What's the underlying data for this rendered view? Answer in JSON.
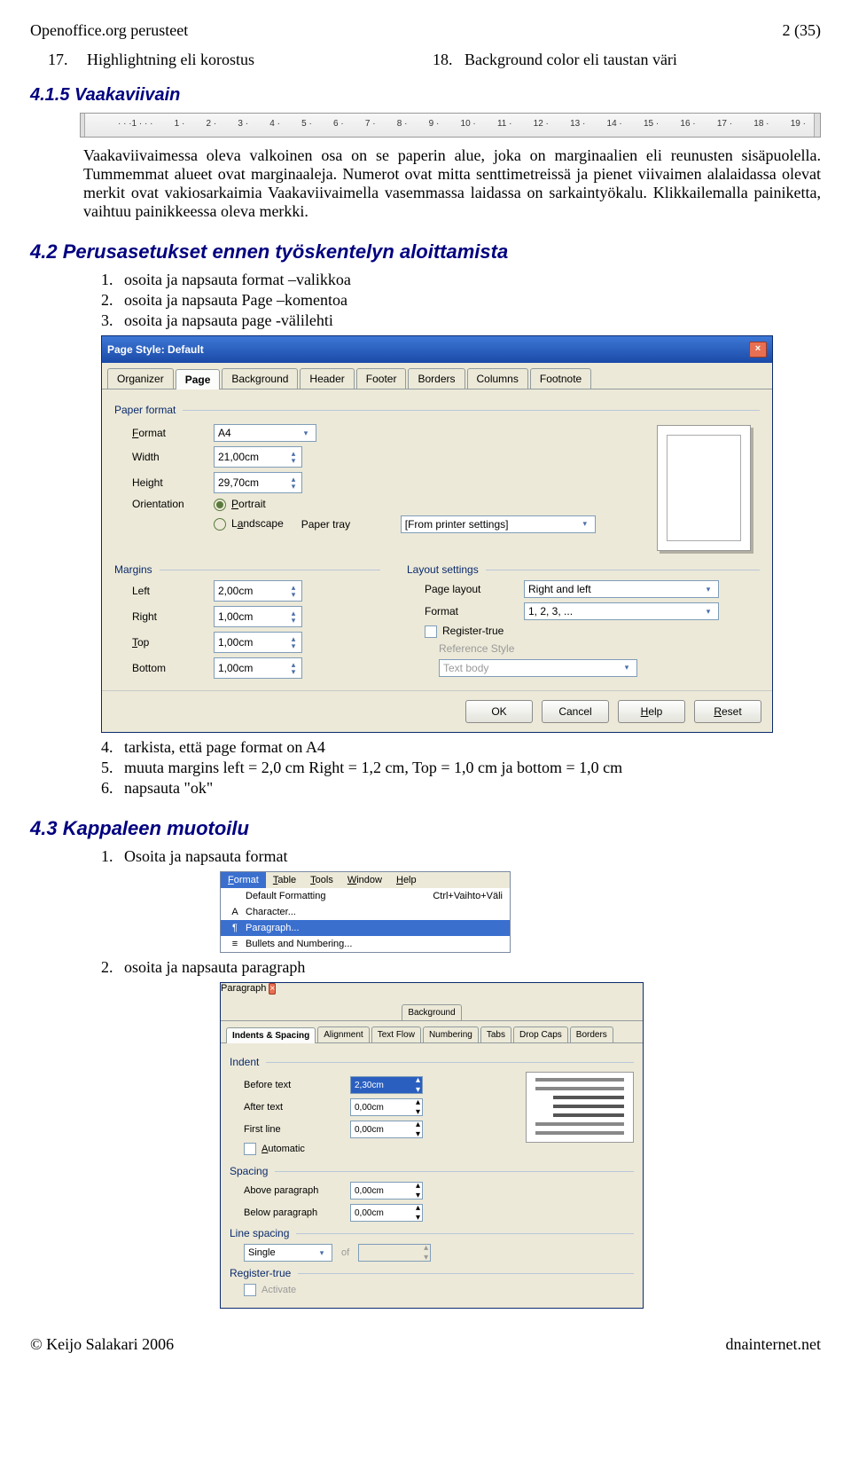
{
  "header": {
    "leftTitle": "Openoffice.org perusteet",
    "pageInfo": "2 (35)"
  },
  "rows": [
    {
      "num": "17.",
      "label": "Highlightning eli korostus",
      "num2": "18.",
      "label2": "Background color eli taustan väri"
    }
  ],
  "section415": {
    "title": "4.1.5  Vaakaviivain",
    "para": "Vaakaviivaimessa oleva valkoinen osa on se paperin alue, joka on marginaalien eli reunusten sisäpuolella. Tummemmat alueet ovat marginaaleja. Numerot ovat mitta senttimetreissä ja pienet viivaimen alalaidassa olevat merkit ovat vakiosarkaimia Vaakaviivaimella vasemmassa laidassa on sarkaintyökalu. Klikkailemalla painiketta, vaihtuu painikkeessa oleva merkki.",
    "ruler_ticks": [
      "1",
      "1",
      "2",
      "3",
      "4",
      "5",
      "6",
      "7",
      "8",
      "9",
      "10",
      "11",
      "12",
      "13",
      "14",
      "15",
      "16",
      "17",
      "18",
      "19"
    ]
  },
  "section42": {
    "title": "4.2  Perusasetukset ennen työskentelyn aloittamista",
    "steps_before": [
      "osoita ja napsauta format –valikkoa",
      "osoita ja napsauta Page –komentoa",
      "osoita ja napsauta page -välilehti"
    ],
    "steps_after": [
      "tarkista, että page format on A4",
      "muuta margins left = 2,0 cm Right = 1,2 cm, Top = 1,0 cm ja bottom = 1,0 cm",
      "napsauta \"ok\""
    ]
  },
  "dialog": {
    "title": "Page Style: Default",
    "tabs": [
      "Organizer",
      "Page",
      "Background",
      "Header",
      "Footer",
      "Borders",
      "Columns",
      "Footnote"
    ],
    "activeTab": "Page",
    "paperFormat": {
      "group": "Paper format",
      "format_lbl": "Format",
      "format_val": "A4",
      "width_lbl": "Width",
      "width_val": "21,00cm",
      "height_lbl": "Height",
      "height_val": "29,70cm",
      "orientation_lbl": "Orientation",
      "portrait": "Portrait",
      "landscape": "Landscape",
      "tray_lbl": "Paper tray",
      "tray_val": "[From printer settings]"
    },
    "margins": {
      "group": "Margins",
      "left_lbl": "Left",
      "left_val": "2,00cm",
      "right_lbl": "Right",
      "right_val": "1,00cm",
      "top_lbl": "Top",
      "top_val": "1,00cm",
      "bottom_lbl": "Bottom",
      "bottom_val": "1,00cm"
    },
    "layout": {
      "group": "Layout settings",
      "pagelayout_lbl": "Page layout",
      "pagelayout_val": "Right and left",
      "format_lbl": "Format",
      "format_val": "1, 2, 3, ...",
      "register_lbl": "Register-true",
      "refstyle_lbl": "Reference Style",
      "refstyle_val": "Text body"
    },
    "buttons": {
      "ok": "OK",
      "cancel": "Cancel",
      "help": "Help",
      "reset": "Reset"
    }
  },
  "section43": {
    "title": "4.3  Kappaleen muotoilu",
    "step1": "Osoita ja napsauta format",
    "step2": "osoita ja napsauta paragraph"
  },
  "menu": {
    "items": [
      "Format",
      "Table",
      "Tools",
      "Window",
      "Help"
    ],
    "dd": [
      {
        "icon": "",
        "label": "Default Formatting",
        "shortcut": "Ctrl+Vaihto+Väli"
      },
      {
        "icon": "A",
        "label": "Character...",
        "shortcut": ""
      },
      {
        "icon": "¶",
        "label": "Paragraph...",
        "shortcut": ""
      },
      {
        "icon": "≡",
        "label": "Bullets and Numbering...",
        "shortcut": ""
      }
    ]
  },
  "paragraphDialog": {
    "title": "Paragraph",
    "tabrow1": [
      "Background"
    ],
    "tabrow2": [
      "Indents & Spacing",
      "Alignment",
      "Text Flow",
      "Numbering",
      "Tabs",
      "Drop Caps",
      "Borders"
    ],
    "activeTab": "Indents & Spacing",
    "indent": {
      "group": "Indent",
      "before_lbl": "Before text",
      "before_val": "2,30cm",
      "after_lbl": "After text",
      "after_val": "0,00cm",
      "first_lbl": "First line",
      "first_val": "0,00cm",
      "auto_lbl": "Automatic"
    },
    "spacing": {
      "group": "Spacing",
      "above_lbl": "Above paragraph",
      "above_val": "0,00cm",
      "below_lbl": "Below paragraph",
      "below_val": "0,00cm"
    },
    "linespacing": {
      "group": "Line spacing",
      "mode": "Single",
      "of_lbl": "of"
    },
    "register": {
      "group": "Register-true",
      "activate_lbl": "Activate"
    }
  },
  "footer": {
    "left": "© Keijo Salakari 2006",
    "right": "dnainternet.net"
  }
}
